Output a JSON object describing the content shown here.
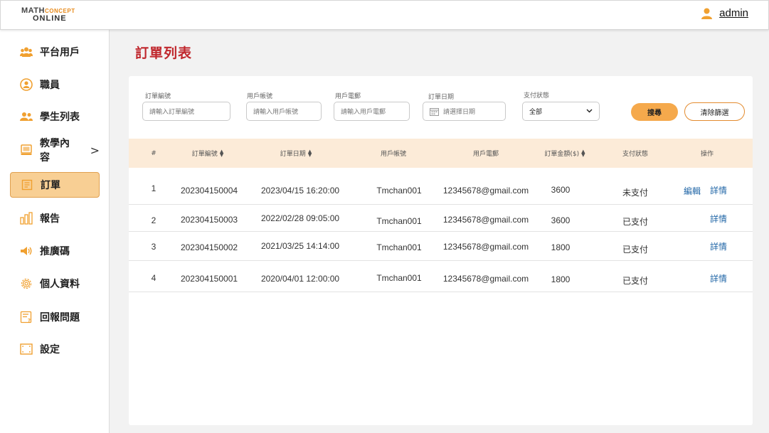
{
  "header": {
    "logo_line1": "MATH",
    "logo_line1b": "CONCEPT",
    "logo_line2": "ONLINE",
    "user_name": "admin"
  },
  "sidebar": {
    "items": [
      {
        "label": "平台用戶",
        "icon": "users-icon"
      },
      {
        "label": "職員",
        "icon": "staff-icon"
      },
      {
        "label": "學生列表",
        "icon": "students-icon"
      },
      {
        "label": "教學內容",
        "icon": "book-icon",
        "chevron": ">"
      },
      {
        "label": "訂單",
        "icon": "order-icon"
      },
      {
        "label": "報告",
        "icon": "bar-chart-icon"
      },
      {
        "label": "推廣碼",
        "icon": "megaphone-icon"
      },
      {
        "label": "個人資料",
        "icon": "gear-icon"
      },
      {
        "label": "回報問題",
        "icon": "report-issue-icon"
      },
      {
        "label": "設定",
        "icon": "settings-icon"
      }
    ]
  },
  "page": {
    "title": "訂單列表"
  },
  "filters": {
    "order_no": {
      "label": "訂單編號",
      "placeholder": "請輸入訂單編號"
    },
    "account": {
      "label": "用戶帳號",
      "placeholder": "請輸入用戶帳號"
    },
    "email": {
      "label": "用戶電郵",
      "placeholder": "請輸入用戶電郵"
    },
    "date": {
      "label": "訂單日期",
      "placeholder": "請選擇日期"
    },
    "status": {
      "label": "支付狀態",
      "value": "全部"
    },
    "search_label": "搜尋",
    "clear_label": "清除篩選"
  },
  "table": {
    "columns": [
      "#",
      "訂單編號",
      "訂單日期",
      "用戶帳號",
      "用戶電郵",
      "訂單金額($)",
      "支付狀態",
      "操作"
    ],
    "rows": [
      {
        "index": "1",
        "order_no": "202304150004",
        "date": "2023/04/15 16:20:00",
        "account": "Tmchan001",
        "email": "12345678@gmail.com",
        "amount": "3600",
        "status": "未支付",
        "edit": "編輯",
        "detail": "詳情"
      },
      {
        "index": "2",
        "order_no": "202304150003",
        "date": "2022/02/28 09:05:00",
        "account": "Tmchan001",
        "email": "12345678@gmail.com",
        "amount": "3600",
        "status": "已支付",
        "detail": "詳情"
      },
      {
        "index": "3",
        "order_no": "202304150002",
        "date": "2021/03/25 14:14:00",
        "account": "Tmchan001",
        "email": "12345678@gmail.com",
        "amount": "1800",
        "status": "已支付",
        "detail": "詳情"
      },
      {
        "index": "4",
        "order_no": "202304150001",
        "date": "2020/04/01 12:00:00",
        "account": "Tmchan001",
        "email": "12345678@gmail.com",
        "amount": "1800",
        "status": "已支付",
        "detail": "詳情"
      }
    ]
  },
  "colors": {
    "accent": "#f5a94c",
    "title": "#c0272d",
    "header_row": "#fcebd8",
    "link": "#2468a8"
  }
}
